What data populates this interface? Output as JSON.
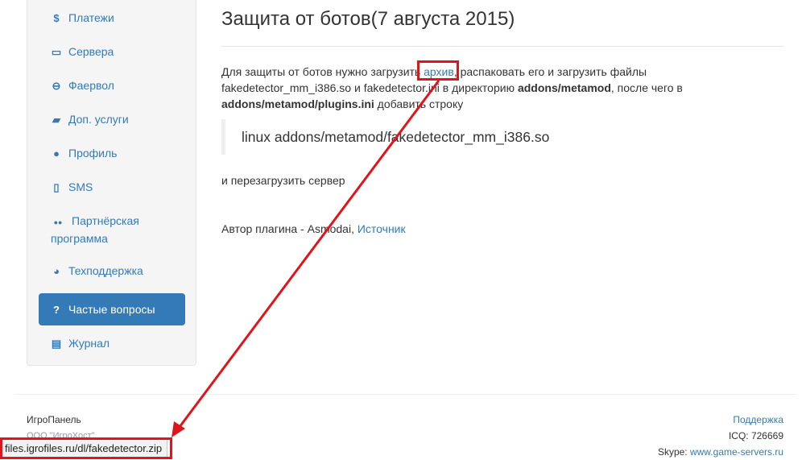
{
  "sidebar": {
    "items": [
      {
        "icon": "dollar-icon",
        "glyph": "$",
        "label": "Платежи"
      },
      {
        "icon": "server-icon",
        "glyph": "▭",
        "label": "Сервера"
      },
      {
        "icon": "minus-circle-icon",
        "glyph": "⊖",
        "label": "Фаервол"
      },
      {
        "icon": "folder-open-icon",
        "glyph": "▰",
        "label": "Доп. услуги"
      },
      {
        "icon": "user-icon",
        "glyph": "●",
        "label": "Профиль"
      },
      {
        "icon": "mobile-icon",
        "glyph": "▯",
        "label": "SMS"
      },
      {
        "icon": "users-icon",
        "glyph": "●●",
        "label": "Партнёрская программа"
      },
      {
        "icon": "comments-icon",
        "glyph": "◕",
        "label": "Техподдержка"
      },
      {
        "icon": "question-icon",
        "glyph": "?",
        "label": "Частые вопросы",
        "active": true
      },
      {
        "icon": "archive-icon",
        "glyph": "▤",
        "label": "Журнал"
      }
    ]
  },
  "main": {
    "title": "Защита от ботов(7 августа 2015)",
    "p_text1": "Для защиты от ботов нужно загрузить ",
    "p_link": "архив",
    "p_text2": ", распаковать его и загрузить файлы fakedetector_mm_i386.so и fakedetector.ini в директорию ",
    "p_bold1": "addons/metamod",
    "p_text3": ", после чего в ",
    "p_bold2": "addons/metamod/plugins.ini",
    "p_text4": " добавить строку",
    "quote": "linux addons/metamod/fakedetector_mm_i386.so",
    "reboot": "и перезагрузить сервер",
    "author_text": "Автор плагина - Asmodai, ",
    "author_link": "Источник"
  },
  "footer": {
    "left_title": "ИгроПанель",
    "left_company": "ООО \"ИгроХост\"",
    "support_link": "Поддержка",
    "icq": "ICQ: 726669",
    "skype_label": "Skype: ",
    "skype_link": "www.game-servers.ru"
  },
  "statusbar": {
    "url": "files.igrofiles.ru/dl/fakedetector.zip"
  },
  "colors": {
    "accent": "#337ab7",
    "annotation": "#e0141a"
  }
}
